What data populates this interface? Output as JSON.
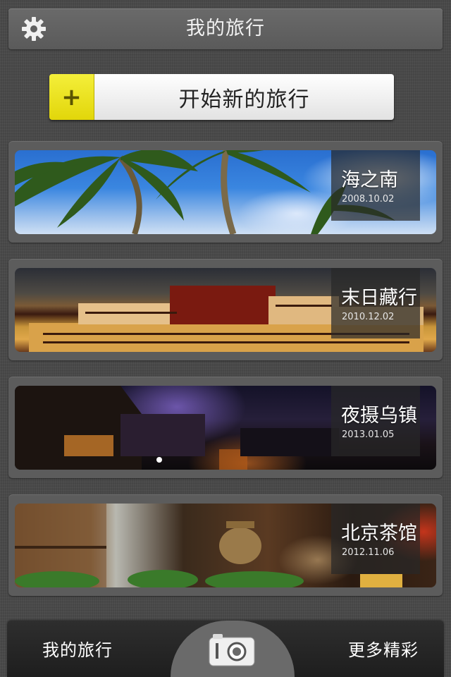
{
  "header": {
    "title": "我的旅行"
  },
  "new_trip": {
    "plus": "+",
    "label": "开始新的旅行"
  },
  "trips": [
    {
      "name": "海之南",
      "date": "2008.10.02"
    },
    {
      "name": "末日藏行",
      "date": "2010.12.02"
    },
    {
      "name": "夜摄乌镇",
      "date": "2013.01.05"
    },
    {
      "name": "北京茶馆",
      "date": "2012.11.06"
    }
  ],
  "tabbar": {
    "left": "我的旅行",
    "right": "更多精彩"
  },
  "icons": {
    "settings": "gear-icon",
    "camera": "camera-icon"
  },
  "colors": {
    "accent": "#e9df1c",
    "background": "#4a4a4a"
  }
}
